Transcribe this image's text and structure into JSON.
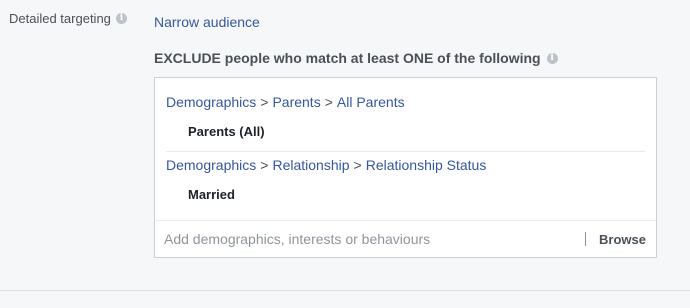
{
  "section": {
    "label": "Detailed targeting",
    "info_icon": "info-icon",
    "narrow_link": "Narrow audience"
  },
  "exclude": {
    "heading": "EXCLUDE people who match at least ONE of the following",
    "info_icon": "info-icon",
    "groups": [
      {
        "path": [
          "Demographics",
          "Parents",
          "All Parents"
        ],
        "separator": ">",
        "item": "Parents (All)"
      },
      {
        "path": [
          "Demographics",
          "Relationship",
          "Relationship Status"
        ],
        "separator": ">",
        "item": "Married"
      }
    ],
    "input_placeholder": "Add demographics, interests or behaviours",
    "browse_label": "Browse"
  },
  "colors": {
    "link": "#365899",
    "background": "#f6f7f9",
    "border": "#ccd0d5"
  }
}
